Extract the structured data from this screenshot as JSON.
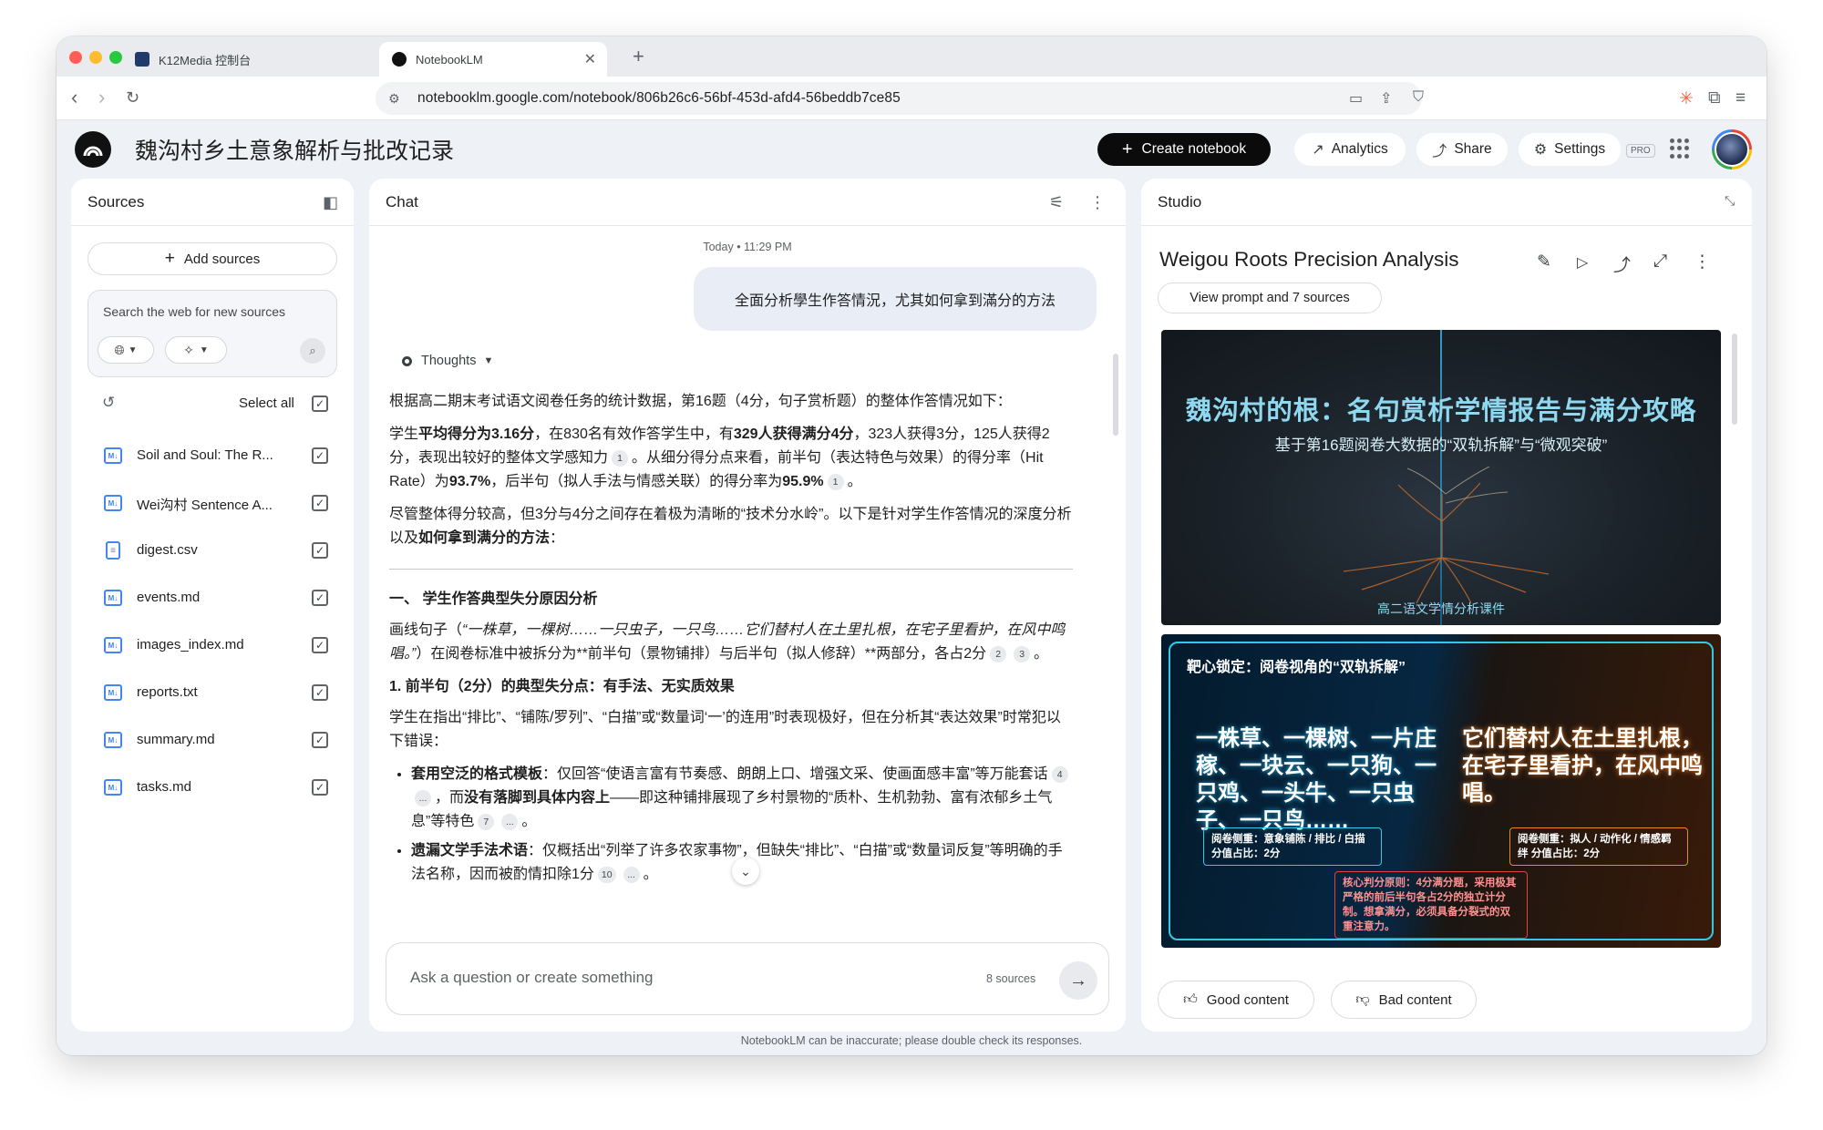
{
  "browser": {
    "tabs": [
      {
        "label": "K12Media 控制台"
      },
      {
        "label": "NotebookLM"
      }
    ],
    "url": "notebooklm.google.com/notebook/806b26c6-56bf-453d-afd4-56beddb7ce85"
  },
  "header": {
    "notebook_title": "魏沟村乡土意象解析与批改记录",
    "create_label": "Create notebook",
    "analytics_label": "Analytics",
    "share_label": "Share",
    "settings_label": "Settings",
    "pro_badge": "PRO"
  },
  "sources": {
    "title": "Sources",
    "add_label": "Add sources",
    "search_placeholder": "Search the web for new sources",
    "select_all": "Select all",
    "items": [
      {
        "name": "Soil and Soul: The R...",
        "icon": "md-file-icon",
        "checked": true
      },
      {
        "name": "Wei沟村 Sentence A...",
        "icon": "md-file-icon",
        "checked": true
      },
      {
        "name": "digest.csv",
        "icon": "doc-file-icon",
        "checked": true
      },
      {
        "name": "events.md",
        "icon": "md-file-icon",
        "checked": true
      },
      {
        "name": "images_index.md",
        "icon": "md-file-icon",
        "checked": true
      },
      {
        "name": "reports.txt",
        "icon": "md-file-icon",
        "checked": true
      },
      {
        "name": "summary.md",
        "icon": "md-file-icon",
        "checked": true
      },
      {
        "name": "tasks.md",
        "icon": "md-file-icon",
        "checked": true
      }
    ]
  },
  "chat": {
    "title": "Chat",
    "timestamp": "Today • 11:29 PM",
    "user_message": "全面分析學生作答情況，尤其如何拿到滿分的方法",
    "thoughts_label": "Thoughts",
    "p1": "根据高二期末考试语文阅卷任务的统计数据，第16题（4分，句子赏析题）的整体作答情况如下：",
    "p2a": "学生",
    "p2b": "平均得分为3.16分",
    "p2c": "，在830名有效作答学生中，有",
    "p2d": "329人获得满分4分",
    "p2e": "，323人获得3分，125人获得2分，表现出较好的整体文学感知力",
    "p2f": "。从细分得分点来看，前半句（表达特色与效果）的得分率（Hit Rate）为",
    "p2g": "93.7%",
    "p2h": "，后半句（拟人手法与情感关联）的得分率为",
    "p2i": "95.9%",
    "p2j": "。",
    "p3a": "尽管整体得分较高，但3分与4分之间存在着极为清晰的“技术分水岭”。以下是针对学生作答情况的深度分析以及",
    "p3b": "如何拿到满分的方法",
    "p3c": "：",
    "h1": "一、 学生作答典型失分原因分析",
    "p4a": "画线句子（",
    "p4b": "“一株草，一棵树……一只虫子，一只鸟……它们替村人在土里扎根，在宅子里看护，在风中鸣唱。”",
    "p4c": "）在阅卷标准中被拆分为**前半句（景物铺排）与后半句（拟人修辞）**两部分，各占2分",
    "h2": "1. 前半句（2分）的典型失分点：有手法、无实质效果",
    "p5": "学生在指出“排比”、“铺陈/罗列”、“白描”或“数量词‘一’的连用”时表现极好，但在分析其“表达效果”时常犯以下错误：",
    "li1a": "套用空泛的格式模板",
    "li1b": "：仅回答“使语言富有节奏感、朗朗上口、增强文采、使画面感丰富”等万能套话",
    "li1c": "，而",
    "li1d": "没有落脚到具体内容上",
    "li1e": "——即这种铺排展现了乡村景物的“质朴、生机勃勃、富有浓郁乡土气息”等特色",
    "li2a": "遗漏文学手法术语",
    "li2b": "：仅概括出“列举了许多农家事物”，但缺失“排比”、“白描”或“数量词反复”等明确的手法名称，因而被酌情扣除1分",
    "cites": {
      "c1": "1",
      "c2": "1",
      "c3": "2",
      "c4": "3",
      "c5": "4",
      "c6": "...",
      "c7": "7",
      "c8": "...",
      "c9": "10",
      "c10": "..."
    },
    "ask_placeholder": "Ask a question or create something",
    "source_count": "8 sources",
    "disclaimer": "NotebookLM can be inaccurate; please double check its responses."
  },
  "studio": {
    "title": "Studio",
    "artifact_title": "Weigou Roots Precision Analysis",
    "view_prompt": "View prompt and 7 sources",
    "slide1": {
      "title": "魏沟村的根：名句赏析学情报告与满分攻略",
      "subtitle": "基于第16题阅卷大数据的“双轨拆解”与“微观突破”",
      "footer": "高二语文学情分析课件"
    },
    "slide2": {
      "heading": "靶心锁定：阅卷视角的“双轨拆解”",
      "left_text": "一株草、一棵树、一片庄稼、一块云、一只狗、一只鸡、一头牛、一只虫子、一只鸟……",
      "right_text": "它们替村人在土里扎根，在宅子里看护，在风中鸣唱。",
      "tag_left": "阅卷侧重：意象铺陈 / 排比 / 白描 分值占比：2分",
      "tag_right": "阅卷侧重：拟人 / 动作化 / 情感羁绊 分值占比：2分",
      "core": "核心判分原则：4分满分题，采用极其严格的前后半句各占2分的独立计分制。想拿满分，必须具备分裂式的双重注意力。"
    },
    "good_label": "Good content",
    "bad_label": "Bad content"
  },
  "colors": {
    "accent": "#0b0b0b",
    "bg": "#eef1f6",
    "link": "#4285f4"
  }
}
